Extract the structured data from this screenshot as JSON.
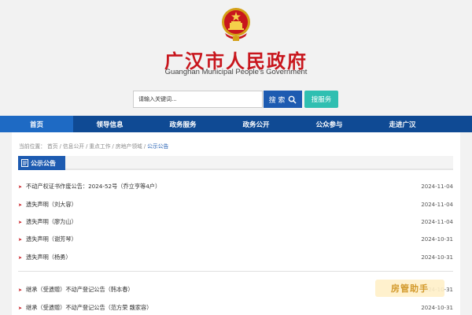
{
  "header": {
    "title": "广汉市人民政府",
    "subtitle": "Guanghan Municipal People's Government"
  },
  "search": {
    "placeholder": "请输入关键词...",
    "button_label": "搜 索",
    "service_label": "搜服务"
  },
  "nav": {
    "items": [
      {
        "label": "首页"
      },
      {
        "label": "领导信息"
      },
      {
        "label": "政务服务"
      },
      {
        "label": "政务公开"
      },
      {
        "label": "公众参与"
      },
      {
        "label": "走进广汉"
      }
    ],
    "active_index": 0
  },
  "breadcrumb": {
    "prefix": "当前位置：",
    "items": [
      "首页",
      "信息公开",
      "重点工作",
      "房地产领域",
      "公示公告"
    ],
    "separator": "/"
  },
  "section": {
    "title": "公示公告"
  },
  "list": {
    "items": [
      {
        "title": "不动产权证书作废公告：2024-52号（乔立亨等4户）",
        "date": "2024-11-04"
      },
      {
        "title": "遗失声明（刘大容）",
        "date": "2024-11-04"
      },
      {
        "title": "遗失声明（廖为山）",
        "date": "2024-11-04"
      },
      {
        "title": "遗失声明（谢芳琴）",
        "date": "2024-10-31"
      },
      {
        "title": "遗失声明（杨勇）",
        "date": "2024-10-31"
      },
      {
        "title": "继承（受遗赠）不动产登记公告（韩本春）",
        "date": "2024-10-31"
      },
      {
        "title": "继承（受遗赠）不动产登记公告（范方荣 魏家容）",
        "date": "2024-10-31"
      }
    ]
  },
  "watermark": {
    "text": "房管助手"
  },
  "colors": {
    "brand_red": "#c8161d",
    "nav_blue": "#0f4a94",
    "accent_blue": "#1d5bb1",
    "service_teal": "#2fbfb1"
  }
}
